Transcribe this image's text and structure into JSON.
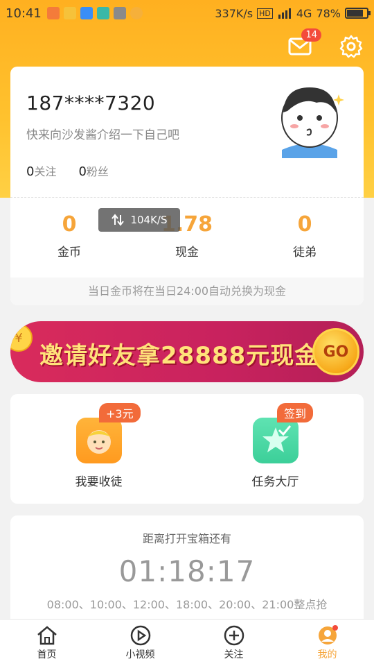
{
  "status_bar": {
    "time": "10:41",
    "speed": "337K/s",
    "network": "4G",
    "battery": "78%"
  },
  "header": {
    "mail_badge": "14"
  },
  "profile": {
    "phone": "187****7320",
    "intro": "快来向沙发酱介绍一下自己吧",
    "following_count": "0",
    "following_label": "关注",
    "fans_count": "0",
    "fans_label": "粉丝"
  },
  "stats": {
    "coins_value": "0",
    "coins_label": "金币",
    "cash_value": "1.78",
    "cash_label": "现金",
    "apprentice_value": "0",
    "apprentice_label": "徒弟",
    "note": "当日金币将在当日24:00自动兑换为现金"
  },
  "toast": {
    "text": "104K/S"
  },
  "banner": {
    "text": "邀请好友拿28888元现金",
    "go": "GO"
  },
  "actions": [
    {
      "label": "我要收徒",
      "tag": "+3元",
      "color": "#ffa629"
    },
    {
      "label": "任务大厅",
      "tag": "签到",
      "color": "#4fd8a5"
    }
  ],
  "timer": {
    "title": "距离打开宝箱还有",
    "countdown": "01:18:17",
    "schedule": "08:00、10:00、12:00、18:00、20:00、21:00整点抢"
  },
  "tabbar": [
    {
      "label": "首页",
      "icon": "home-icon"
    },
    {
      "label": "小视频",
      "icon": "play-icon"
    },
    {
      "label": "关注",
      "icon": "plus-circle-icon"
    },
    {
      "label": "我的",
      "icon": "profile-icon",
      "active": true
    }
  ],
  "colors": {
    "accent": "#f6a53a",
    "header_bg": "#ffb020",
    "badge": "#f34b3b"
  }
}
